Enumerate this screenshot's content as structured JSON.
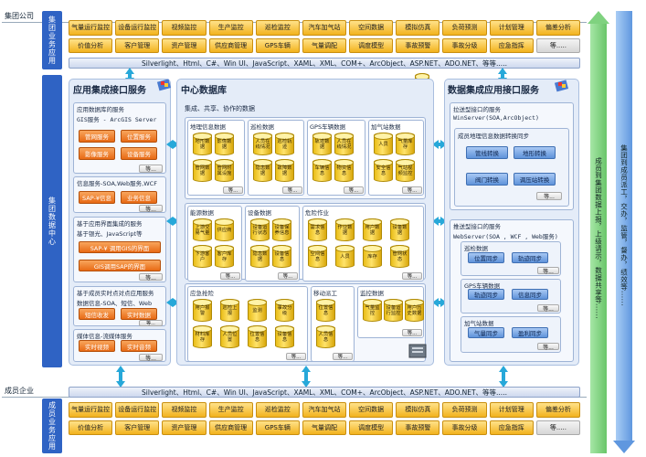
{
  "zones": {
    "group": "集团公司",
    "member": "成员企业"
  },
  "left_labels": {
    "group_apps": "集团业务应用",
    "data_center": "集团数据中心",
    "member_apps": "成员业务应用"
  },
  "business_buttons": [
    "气量运行监控",
    "设备运行监控",
    "视频监控",
    "生产监控",
    "巡检监控",
    "汽车加气站",
    "空间数据",
    "模拟仿真",
    "负荷预测",
    "计划管理",
    "偏差分析",
    "价值分析",
    "客户管理",
    "资产管理",
    "供应商管理",
    "GPS车辆",
    "气量调配",
    "调度模型",
    "事故预警",
    "事故分级",
    "应急指挥",
    "等....."
  ],
  "tech_bar": "Silverlight、Html、C#、Win UI、JavaScript、XAML、XML、COM+、ArcObject、ASP.NET、ADO.NET、等等.....",
  "left_panel": {
    "title": "应用集成接口服务",
    "s1": {
      "title": "应用数据库的服务",
      "desc": "GIS服务 - ArcGIS Server",
      "b1": "管网服务",
      "b2": "位置服务",
      "b3": "影像服务",
      "b4": "设备服务",
      "etc": "等..."
    },
    "s2": {
      "desc": "信息服务-SOA,Web服务,WCF",
      "b1": "SAP-¥信息",
      "b2": "业务信息",
      "etc": "等..."
    },
    "s3": {
      "title": "基于应用界面集成的服务",
      "desc": "基于银光、JavaScript等",
      "b1": "SAP-¥ 调用GIS的界面",
      "b2": "GIS调用SAP的界面",
      "etc": "等..."
    },
    "s4": {
      "title": "基于成员实时点对点应用服务",
      "desc": "数据信息-SOA、短信、Web",
      "b1": "短信收发",
      "b2": "实时数据",
      "etc": "等..."
    },
    "s5": {
      "title": "媒体信息-流媒体服务",
      "b1": "实时视频",
      "b2": "实时音频",
      "etc": "等..."
    }
  },
  "center_panel": {
    "title": "中心数据库",
    "subtitle": "集成、共享、协作的数据",
    "geo": {
      "title": "地理信息数据",
      "items": [
        "地形数据",
        "影像数据",
        "管网数据",
        "管网附属设施"
      ],
      "etc": "等..."
    },
    "patrol": {
      "title": "巡检数据",
      "items": [
        "人员在线情况",
        "巡检轨迹",
        "隐患数据",
        "故障数据"
      ],
      "etc": "等..."
    },
    "gps": {
      "title": "GPS车辆数据",
      "items": [
        "轨迹数据",
        "人员在线情况",
        "车辆信息",
        "物资信息"
      ],
      "etc": "等..."
    },
    "station": {
      "title": "加气站数据",
      "items": [
        "人员",
        "气量库存",
        "安全信息",
        "气站视频监控"
      ],
      "etc": "等..."
    },
    "energy": {
      "title": "能源数据",
      "items": [
        "上游交易气量",
        "供应商",
        "下游客户",
        "客户库存"
      ],
      "etc": "等..."
    },
    "equip": {
      "title": "设备数据",
      "items": [
        "设备运行状态",
        "设备保养信息",
        "隐患数据",
        "设备信息"
      ],
      "etc": "等..."
    },
    "hazard": {
      "title": "危险作业",
      "items": [
        "需求信息",
        "作业数据",
        "用户数据",
        "设备数据",
        "空间信息",
        "人员",
        "库存",
        "管网状态"
      ],
      "etc": "等..."
    },
    "emerg": {
      "title": "应急抢险",
      "items": [
        "用户报警",
        "巡检上报",
        "监测",
        "事故分级",
        "材料库存",
        "人员位置",
        "位置信息",
        "设备信息"
      ],
      "etc": "等..."
    },
    "dispatch": {
      "title": "移动派工",
      "items": [
        "位置信息",
        "人员信息"
      ],
      "etc": "等..."
    },
    "monitor": {
      "title": "监控数据",
      "items": [
        "气量监控",
        "设备运行监控",
        "用户历史数据"
      ],
      "etc": "等..."
    }
  },
  "right_panel": {
    "title": "数据集成应用接口服务",
    "s1": {
      "title": "拉送型接口的服务",
      "desc": "WinServer(SOA,ArcObject)",
      "sub": "成员地理信息数据转换同步",
      "b1": "管线转换",
      "b2": "地形转换",
      "b3": "阀门转换",
      "b4": "调压站转换",
      "etc": "等..."
    },
    "s2": {
      "title": "推送型接口的服务",
      "desc": "WebServer(SOA , WCF , Web服务)",
      "g1": {
        "title": "巡检数据",
        "b1": "位置同步",
        "b2": "轨迹同步",
        "etc": "等..."
      },
      "g2": {
        "title": "GPS车辆数据",
        "b1": "轨迹同步",
        "b2": "信息同步",
        "etc": "等..."
      },
      "g3": {
        "title": "加气站数据",
        "b1": "气量同步",
        "b2": "盈利同步",
        "etc": "等..."
      }
    }
  },
  "right_bars": {
    "upload": "成员到集团数据上报，上级请示，数据共享等......",
    "dispatch": "集团到成员派工，交办，监管，督办，绩效等......"
  },
  "colors": {
    "blue_label": "#2f63c4",
    "arrow": "#27a8d9",
    "panel_bg": "#e4ecf8",
    "green_bar": "#8fd88f",
    "blue_bar": "#7fb0e8"
  }
}
